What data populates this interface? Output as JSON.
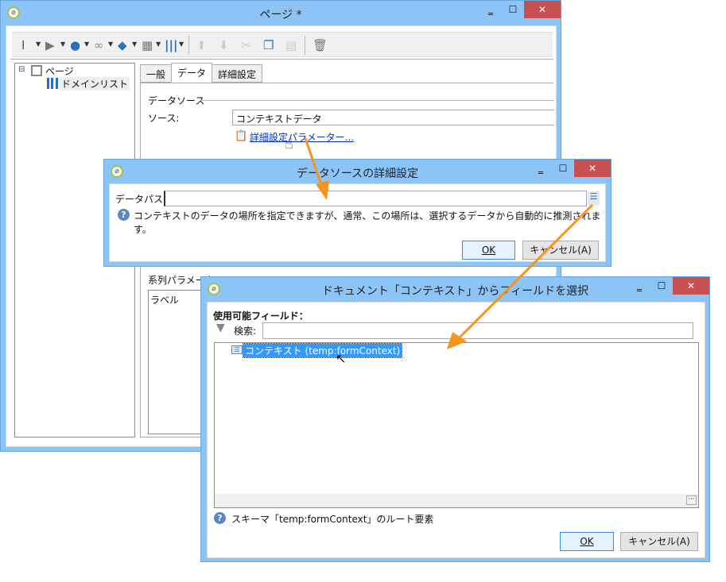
{
  "main_window": {
    "title": "ページ *",
    "controls": {
      "minimize": "‗",
      "maximize": "☐",
      "close": "✕"
    },
    "toolbar": {
      "icons": [
        "text-field-icon",
        "input-settings-icon",
        "globe-icon",
        "link-icon",
        "layers-icon",
        "grid-icon",
        "columns-icon",
        "arrow-up-icon",
        "arrow-down-icon",
        "cut-icon",
        "copy-icon",
        "paste-icon",
        "trash-icon"
      ]
    },
    "tree": {
      "root": "ページ",
      "child": "ドメインリスト",
      "expander": "⊟"
    },
    "tabs": [
      {
        "label": "一般"
      },
      {
        "label": "データ",
        "active": true
      },
      {
        "label": "詳細設定"
      }
    ],
    "data_source_group": "データソース",
    "source_label": "ソース:",
    "source_value": "コンテキストデータ",
    "advanced_link": "詳細設定パラメーター...",
    "series_group": "系列パラメータ",
    "series_column": "ラベル"
  },
  "advanced_dialog": {
    "title": "データソースの詳細設定",
    "controls": {
      "minimize": "‗",
      "maximize": "☐",
      "close": "✕"
    },
    "data_path_label": "データパス:",
    "data_path_value": "",
    "info": "コンテキストのデータの場所を指定できますが、通常、この場所は、選択するデータから自動的に推測されます。",
    "ok": "OK",
    "cancel": "キャンセル(A)"
  },
  "field_dialog": {
    "title": "ドキュメント「コンテキスト」からフィールドを選択",
    "controls": {
      "minimize": "‗",
      "maximize": "☐",
      "close": "✕"
    },
    "available_label": "使用可能フィールド：",
    "search_label": "検索:",
    "search_value": "",
    "items": [
      {
        "label": "コンテキスト (temp:formContext)",
        "selected": true
      }
    ],
    "info": "スキーマ「temp:formContext」のルート要素",
    "ok": "OK",
    "cancel": "キャンセル(A)"
  },
  "colors": {
    "window_frame": "#8cc4f5",
    "close": "#c75050",
    "selection": "#3399ff",
    "annotation_arrow": "#f7941d",
    "link": "#0033cc"
  }
}
